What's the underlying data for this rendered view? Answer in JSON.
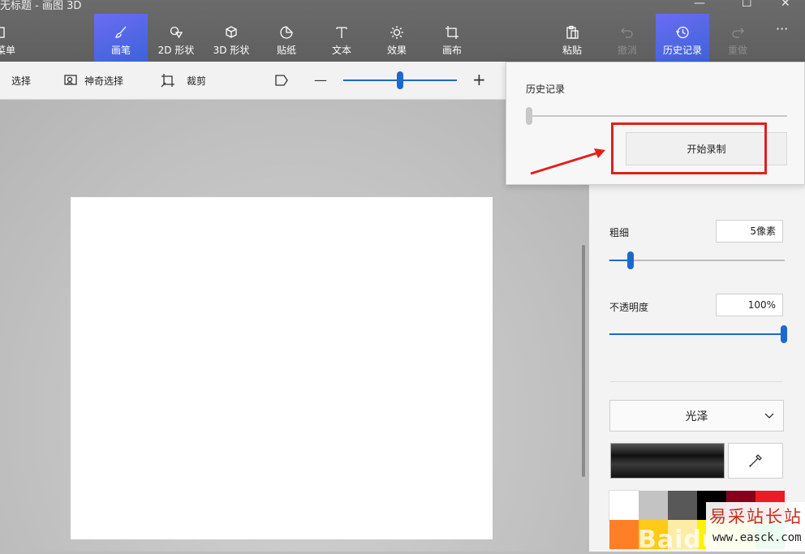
{
  "window": {
    "title": "无标题 - 画图 3D",
    "controls": [
      "—",
      "☐",
      "✕"
    ]
  },
  "ribbon": {
    "menu_label": "菜单",
    "tools": [
      {
        "label": "画笔",
        "icon": "brush-icon",
        "active": true
      },
      {
        "label": "2D 形状",
        "icon": "2d-shapes-icon"
      },
      {
        "label": "3D 形状",
        "icon": "3d-shapes-icon"
      },
      {
        "label": "贴纸",
        "icon": "sticker-icon"
      },
      {
        "label": "文本",
        "icon": "text-icon"
      },
      {
        "label": "效果",
        "icon": "effects-icon"
      },
      {
        "label": "画布",
        "icon": "canvas-icon"
      }
    ],
    "right_tools": [
      {
        "label": "粘贴",
        "icon": "paste-icon"
      },
      {
        "label": "撤消",
        "icon": "undo-icon",
        "disabled": true
      },
      {
        "label": "历史记录",
        "icon": "history-icon",
        "active": true
      },
      {
        "label": "重做",
        "icon": "redo-icon",
        "disabled": true
      }
    ],
    "more": "···"
  },
  "subbar": {
    "select_label": "选择",
    "magic_select_label": "神奇选择",
    "crop_label": "裁剪",
    "zoom_minus": "—",
    "zoom_plus": "+"
  },
  "history": {
    "title": "历史记录",
    "start_record_label": "开始录制"
  },
  "brush_panel": {
    "thickness_label": "粗细",
    "thickness_value": "5像素",
    "thickness_fraction": 0.05,
    "opacity_label": "不透明度",
    "opacity_value": "100%",
    "opacity_fraction": 1.0,
    "finish_selected": "光泽"
  },
  "palette": {
    "row1": [
      "#ffffff",
      "#c3c3c3",
      "#585858",
      "#000000",
      "#88001b",
      "#ec1c24"
    ],
    "row2": [
      "#ff7f27",
      "#ffca18",
      "#fdeca6",
      "#fff200",
      "#c4ff0e",
      "#0ed145"
    ]
  },
  "colors": {
    "accent": "#1b6ac9",
    "annotation_red": "#e0201c"
  },
  "watermarks": {
    "easck_cn": "易采站长站",
    "easck_url": "www.easck.com",
    "baidu": "Baidu"
  }
}
